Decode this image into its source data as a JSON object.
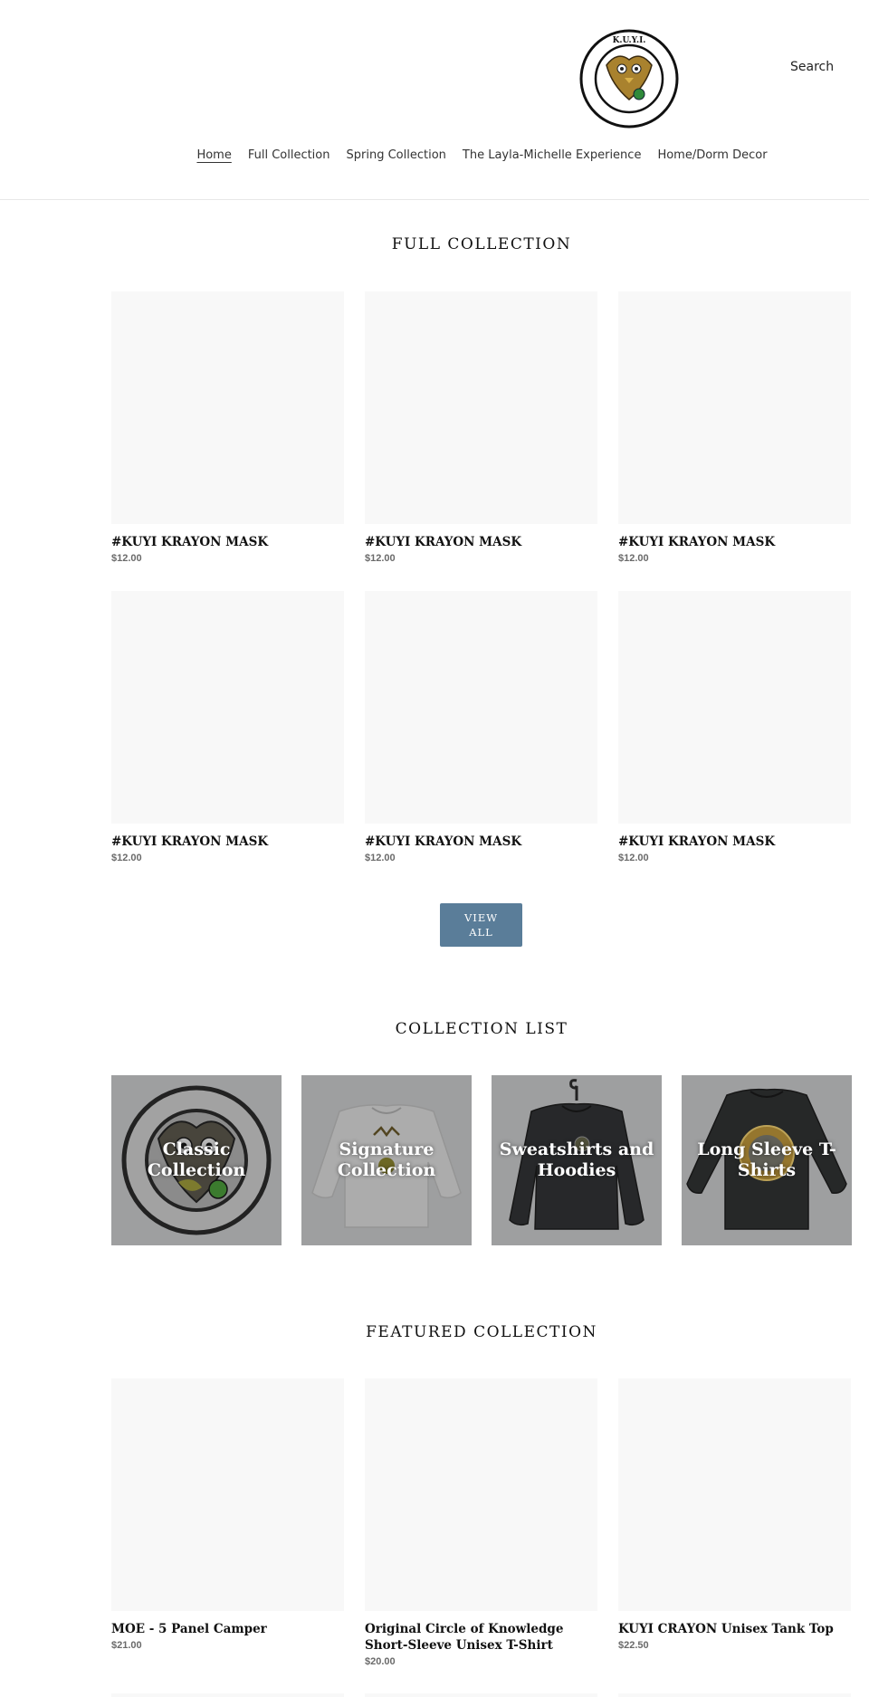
{
  "header": {
    "search_label": "Search",
    "logo_alt": "K.U.Y.I. KNOWLEDGE UNVEILS YOUR INTELLIGENCE",
    "nav": [
      {
        "label": "Home",
        "active": true
      },
      {
        "label": "Full Collection",
        "active": false
      },
      {
        "label": "Spring Collection",
        "active": false
      },
      {
        "label": "The Layla-Michelle Experience",
        "active": false
      },
      {
        "label": "Home/Dorm Decor",
        "active": false
      }
    ]
  },
  "full_collection": {
    "title": "FULL COLLECTION",
    "products": [
      {
        "name": "#KUYI KRAYON MASK",
        "price": "$12.00"
      },
      {
        "name": "#KUYI KRAYON MASK",
        "price": "$12.00"
      },
      {
        "name": "#KUYI KRAYON MASK",
        "price": "$12.00"
      },
      {
        "name": "#KUYI KRAYON MASK",
        "price": "$12.00"
      },
      {
        "name": "#KUYI KRAYON MASK",
        "price": "$12.00"
      },
      {
        "name": "#KUYI KRAYON MASK",
        "price": "$12.00"
      }
    ],
    "view_all_label": "VIEW ALL"
  },
  "collection_list": {
    "title": "COLLECTION LIST",
    "items": [
      {
        "label": "Classic Collection",
        "image": "owl-logo"
      },
      {
        "label": "Signature Collection",
        "image": "grey-sweatshirt"
      },
      {
        "label": "Sweatshirts and Hoodies",
        "image": "black-sweatshirt"
      },
      {
        "label": "Long Sleeve T-Shirts",
        "image": "black-long-sleeve"
      }
    ]
  },
  "featured_collection": {
    "title": "FEATURED COLLECTION",
    "products": [
      {
        "name": "MOE - 5 Panel Camper",
        "price": "$21.00"
      },
      {
        "name": "Original Circle of Knowledge Short-Sleeve Unisex T-Shirt",
        "price": "$20.00"
      },
      {
        "name": "KUYI CRAYON Unisex Tank Top",
        "price": "$22.50"
      }
    ]
  },
  "colors": {
    "accent_button": "#5a7d99",
    "placeholder": "#f8f8f8",
    "collection_bg": "#b3b4b6"
  }
}
